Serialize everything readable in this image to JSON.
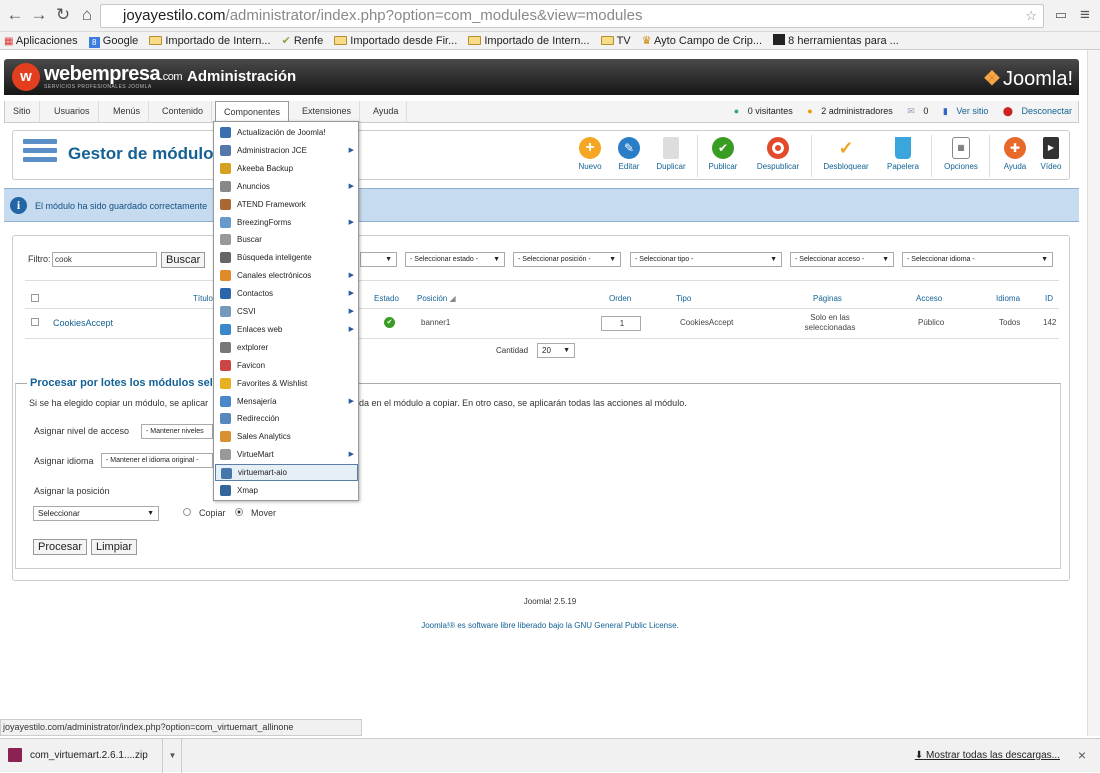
{
  "browser": {
    "url_host": "joyayestilo.com",
    "url_path": "/administrator/index.php?option=com_modules&view=modules",
    "bookmarks": [
      "Aplicaciones",
      "Google",
      "Importado de Intern...",
      "Renfe",
      "Importado desde Fir...",
      "Importado de Intern...",
      "TV",
      "Ayto Campo de Crip...",
      "8 herramientas para ..."
    ],
    "status_url": "joyayestilo.com/administrator/index.php?option=com_virtuemart_allinone",
    "download_file": "com_virtuemart.2.6.1....zip",
    "download_all": "Mostrar todas las descargas...",
    "download_close": "×"
  },
  "header": {
    "brand": "webempresa",
    "brand_suffix": ".com",
    "brand_sub": "SERVICIOS PROFESIONALES JOOMLA",
    "title": "Administración",
    "joomla": "Joomla!"
  },
  "menu": [
    "Sitio",
    "Usuarios",
    "Menús",
    "Contenido",
    "Componentes",
    "Extensiones",
    "Ayuda"
  ],
  "status": {
    "visitors": "0 visitantes",
    "admins": "2 administradores",
    "messages": "0",
    "view_site": "Ver sitio",
    "logout": "Desconectar"
  },
  "toolbar": {
    "page_title": "Gestor de módulo",
    "buttons": [
      "Nuevo",
      "Editar",
      "Duplicar",
      "Publicar",
      "Despublicar",
      "Desbloquear",
      "Papelera",
      "Opciones",
      "Ayuda",
      "Vídeo"
    ]
  },
  "message": "El módulo ha sido guardado correctamente",
  "filter": {
    "label": "Filtro:",
    "value": "cook",
    "search": "Buscar",
    "selects": [
      "- Seleccionar estado -",
      "- Seleccionar posición -",
      "- Seleccionar tipo -",
      "- Seleccionar acceso -",
      "- Seleccionar idioma -"
    ]
  },
  "table": {
    "headers": [
      "Título",
      "Estado",
      "Posición",
      "Orden",
      "Tipo",
      "Páginas",
      "Acceso",
      "Idioma",
      "ID"
    ],
    "row": {
      "title": "CookiesAccept",
      "position": "banner1",
      "order": "1",
      "type": "CookiesAccept",
      "pages": "Solo en las seleccionadas",
      "access": "Público",
      "language": "Todos",
      "id": "142"
    },
    "count_label": "Cantidad",
    "count_value": "20"
  },
  "batch": {
    "title": "Procesar por lotes los módulos selec",
    "description_left": "Si se ha elegido copiar un módulo, se aplicar",
    "description_right": "da en el módulo a copiar. En otro caso, se aplicarán todas las acciones al módulo.",
    "access_label": "Asignar nivel de acceso",
    "access_value": "- Mantener niveles",
    "language_label": "Asignar idioma",
    "language_value": "- Mantener el idioma original -",
    "position_label": "Asignar la posición",
    "position_value": "Seleccionar",
    "copy": "Copiar",
    "move": "Mover",
    "process": "Procesar",
    "clear": "Limpiar"
  },
  "footer": {
    "version": "Joomla! 2.5.19",
    "license_prefix": "Joomla!® es software libre liberado bajo la",
    "license_link": "GNU General Public License."
  },
  "dropdown": [
    {
      "label": "Actualización de Joomla!",
      "sub": false,
      "color": "#3b6fb0"
    },
    {
      "label": "Administracion JCE",
      "sub": true,
      "color": "#5577aa"
    },
    {
      "label": "Akeeba Backup",
      "sub": false,
      "color": "#d8a020"
    },
    {
      "label": "Anuncios",
      "sub": true,
      "color": "#888888"
    },
    {
      "label": "ATEND Framework",
      "sub": false,
      "color": "#aa6633"
    },
    {
      "label": "BreezingForms",
      "sub": true,
      "color": "#6699cc"
    },
    {
      "label": "Buscar",
      "sub": false,
      "color": "#999999"
    },
    {
      "label": "Búsqueda inteligente",
      "sub": false,
      "color": "#666666"
    },
    {
      "label": "Canales electrónicos",
      "sub": true,
      "color": "#e08a2a"
    },
    {
      "label": "Contactos",
      "sub": true,
      "color": "#2a66aa"
    },
    {
      "label": "CSVI",
      "sub": true,
      "color": "#7799bb"
    },
    {
      "label": "Enlaces web",
      "sub": true,
      "color": "#3a88cc"
    },
    {
      "label": "extplorer",
      "sub": false,
      "color": "#777777"
    },
    {
      "label": "Favicon",
      "sub": false,
      "color": "#cc4444"
    },
    {
      "label": "Favorites & Wishlist",
      "sub": false,
      "color": "#e8b020"
    },
    {
      "label": "Mensajería",
      "sub": true,
      "color": "#4a88c8"
    },
    {
      "label": "Redirección",
      "sub": false,
      "color": "#5588bb"
    },
    {
      "label": "Sales Analytics",
      "sub": false,
      "color": "#d89030"
    },
    {
      "label": "VirtueMart",
      "sub": true,
      "color": "#999999"
    },
    {
      "label": "virtuemart-aio",
      "sub": false,
      "color": "#4477aa"
    },
    {
      "label": "Xmap",
      "sub": false,
      "color": "#336699"
    }
  ],
  "colors": {
    "link": "#146295",
    "accent_red": "#e33f1f",
    "message_bg": "#c6dbef"
  }
}
